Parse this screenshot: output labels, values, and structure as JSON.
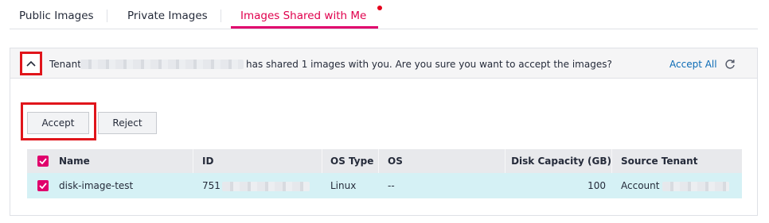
{
  "tabs": {
    "public": "Public Images",
    "private": "Private Images",
    "shared": "Images Shared with Me"
  },
  "notice": {
    "tenant_label": "Tenant",
    "message": "has shared 1 images with you. Are you sure you want to accept the images?",
    "accept_all": "Accept All"
  },
  "actions": {
    "accept": "Accept",
    "reject": "Reject"
  },
  "table": {
    "columns": [
      "Name",
      "ID",
      "OS Type",
      "OS",
      "Disk Capacity (GB)",
      "Source Tenant"
    ],
    "rows": [
      {
        "name": "disk-image-test",
        "id_prefix": "751",
        "os_type": "Linux",
        "os": "--",
        "disk_capacity": "100",
        "source_tenant_prefix": "Account"
      }
    ]
  },
  "colors": {
    "accent": "#e0006c",
    "link": "#0b6bb5",
    "highlight_border": "#e0151b",
    "selected_row": "#d5f1f5"
  },
  "icons": {
    "toggle": "chevron-up-icon",
    "refresh": "refresh-icon",
    "checkbox": "check-icon"
  }
}
